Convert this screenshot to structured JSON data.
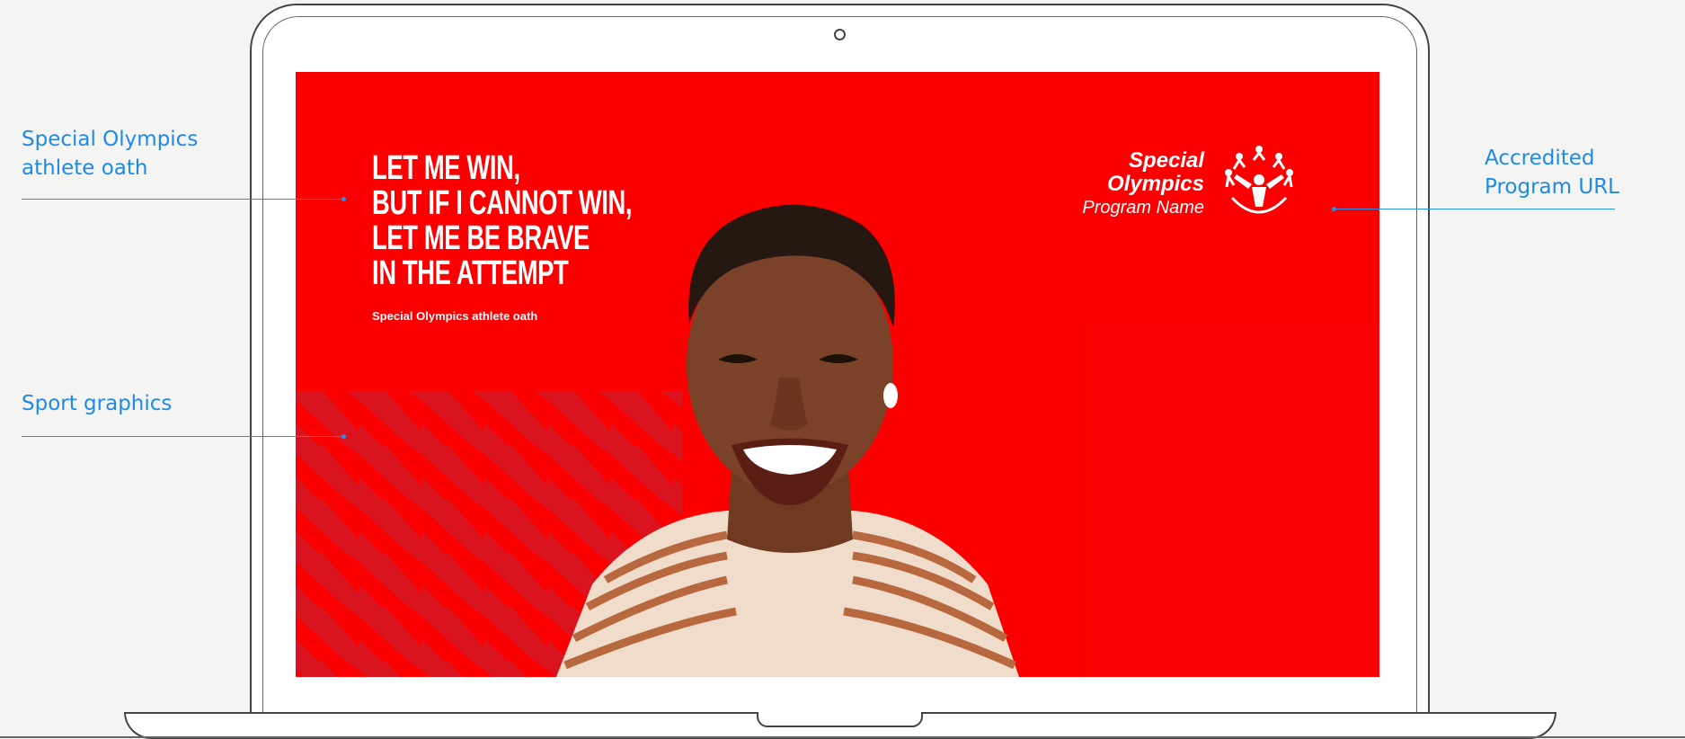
{
  "annotations": {
    "oath_label_line1": "Special Olympics",
    "oath_label_line2": "athlete oath",
    "sport_label": "Sport graphics",
    "url_label_line1": "Accredited",
    "url_label_line2": "Program URL"
  },
  "screen": {
    "background_color": "#fb0000",
    "oath_lines": [
      "LET ME WIN,",
      "BUT IF I CANNOT WIN,",
      "LET ME BE BRAVE",
      "IN THE ATTEMPT"
    ],
    "oath_credit": "Special Olympics athlete oath",
    "logo": {
      "line1": "Special",
      "line2": "Olympics",
      "program": "Program Name"
    }
  },
  "colors": {
    "annotation": "#1f8ae6",
    "accent_red": "#fb0000"
  }
}
